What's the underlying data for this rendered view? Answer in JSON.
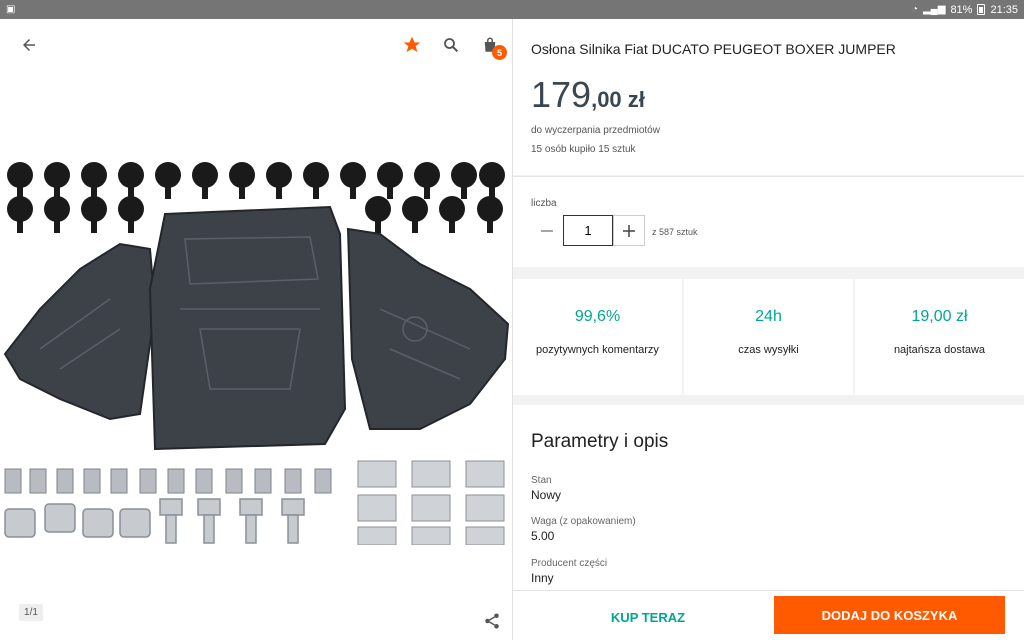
{
  "status_bar": {
    "battery": "81%",
    "time": "21:35"
  },
  "header": {
    "cart_count": "5"
  },
  "gallery": {
    "pager": "1/1"
  },
  "product": {
    "title": "Osłona Silnika Fiat DUCATO PEUGEOT BOXER JUMPER",
    "price_int": "179",
    "price_dec": ",00 zł",
    "availability": "do wyczerpania przedmiotów",
    "sold_info": "15 osób kupiło 15 sztuk"
  },
  "quantity": {
    "label": "liczba",
    "value": "1",
    "stock": "z 587 sztuk"
  },
  "stats": [
    {
      "value": "99,6%",
      "label": "pozytywnych komentarzy"
    },
    {
      "value": "24h",
      "label": "czas wysyłki"
    },
    {
      "value": "19,00 zł",
      "label": "najtańsza dostawa"
    }
  ],
  "params": {
    "title": "Parametry i opis",
    "items": [
      {
        "label": "Stan",
        "value": "Nowy"
      },
      {
        "label": "Waga (z opakowaniem)",
        "value": "5.00"
      },
      {
        "label": "Producent części",
        "value": "Inny"
      }
    ]
  },
  "actions": {
    "buy_now": "KUP TERAZ",
    "add_to_cart": "DODAJ DO KOSZYKA"
  },
  "colors": {
    "accent": "#ff5a00",
    "teal": "#00a790",
    "status_bar": "#757575"
  }
}
